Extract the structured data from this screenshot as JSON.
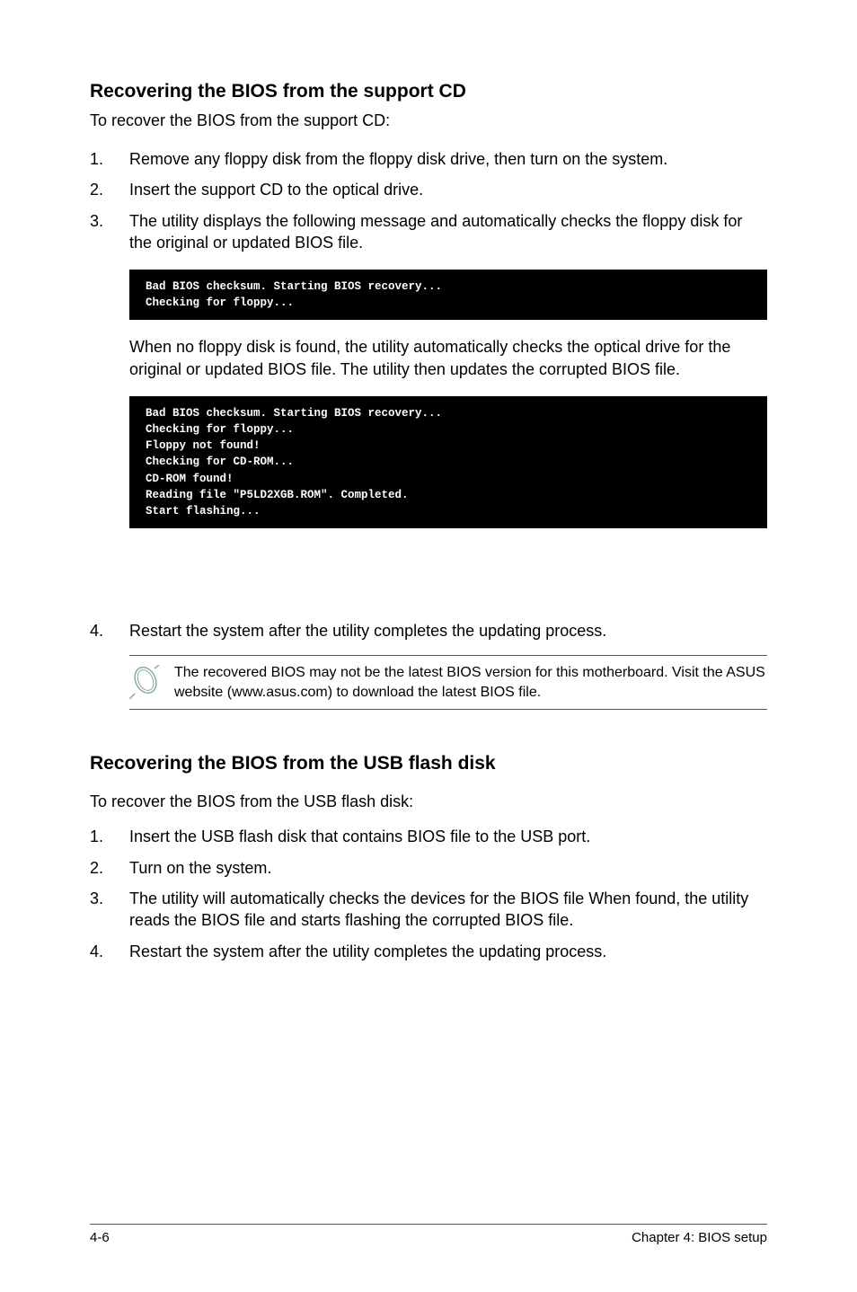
{
  "section1": {
    "heading": "Recovering the BIOS from the support CD",
    "intro": "To recover the BIOS from the support CD:",
    "steps": [
      "Remove any floppy disk from the floppy disk drive, then turn on the system.",
      "Insert the support CD to the optical drive.",
      "The utility displays the following message and automatically checks the floppy disk for the original or updated BIOS file."
    ],
    "terminal1": "Bad BIOS checksum. Starting BIOS recovery...\nChecking for floppy...",
    "cont1": "When no floppy disk is found, the utility automatically checks the optical drive for the original or updated BIOS file. The utility then updates the corrupted BIOS file.",
    "terminal2": "Bad BIOS checksum. Starting BIOS recovery...\nChecking for floppy...\nFloppy not found!\nChecking for CD-ROM...\nCD-ROM found!\nReading file \"P5LD2XGB.ROM\". Completed.\nStart flashing...",
    "step4": "Restart the system after the utility completes the updating process.",
    "note": "The recovered BIOS may not be the latest BIOS version for this motherboard. Visit the ASUS website (www.asus.com) to download the latest BIOS file."
  },
  "section2": {
    "heading": "Recovering the BIOS from the USB flash disk",
    "intro": "To recover the BIOS from the USB flash disk:",
    "steps": [
      "Insert the USB flash disk that contains BIOS file to the USB port.",
      "Turn on the system.",
      "The utility will automatically checks the devices for the BIOS file When found, the utility reads the BIOS file and starts flashing the corrupted BIOS file.",
      "Restart the system after the utility completes the updating process."
    ]
  },
  "footer": {
    "left": "4-6",
    "right": "Chapter 4: BIOS setup"
  }
}
